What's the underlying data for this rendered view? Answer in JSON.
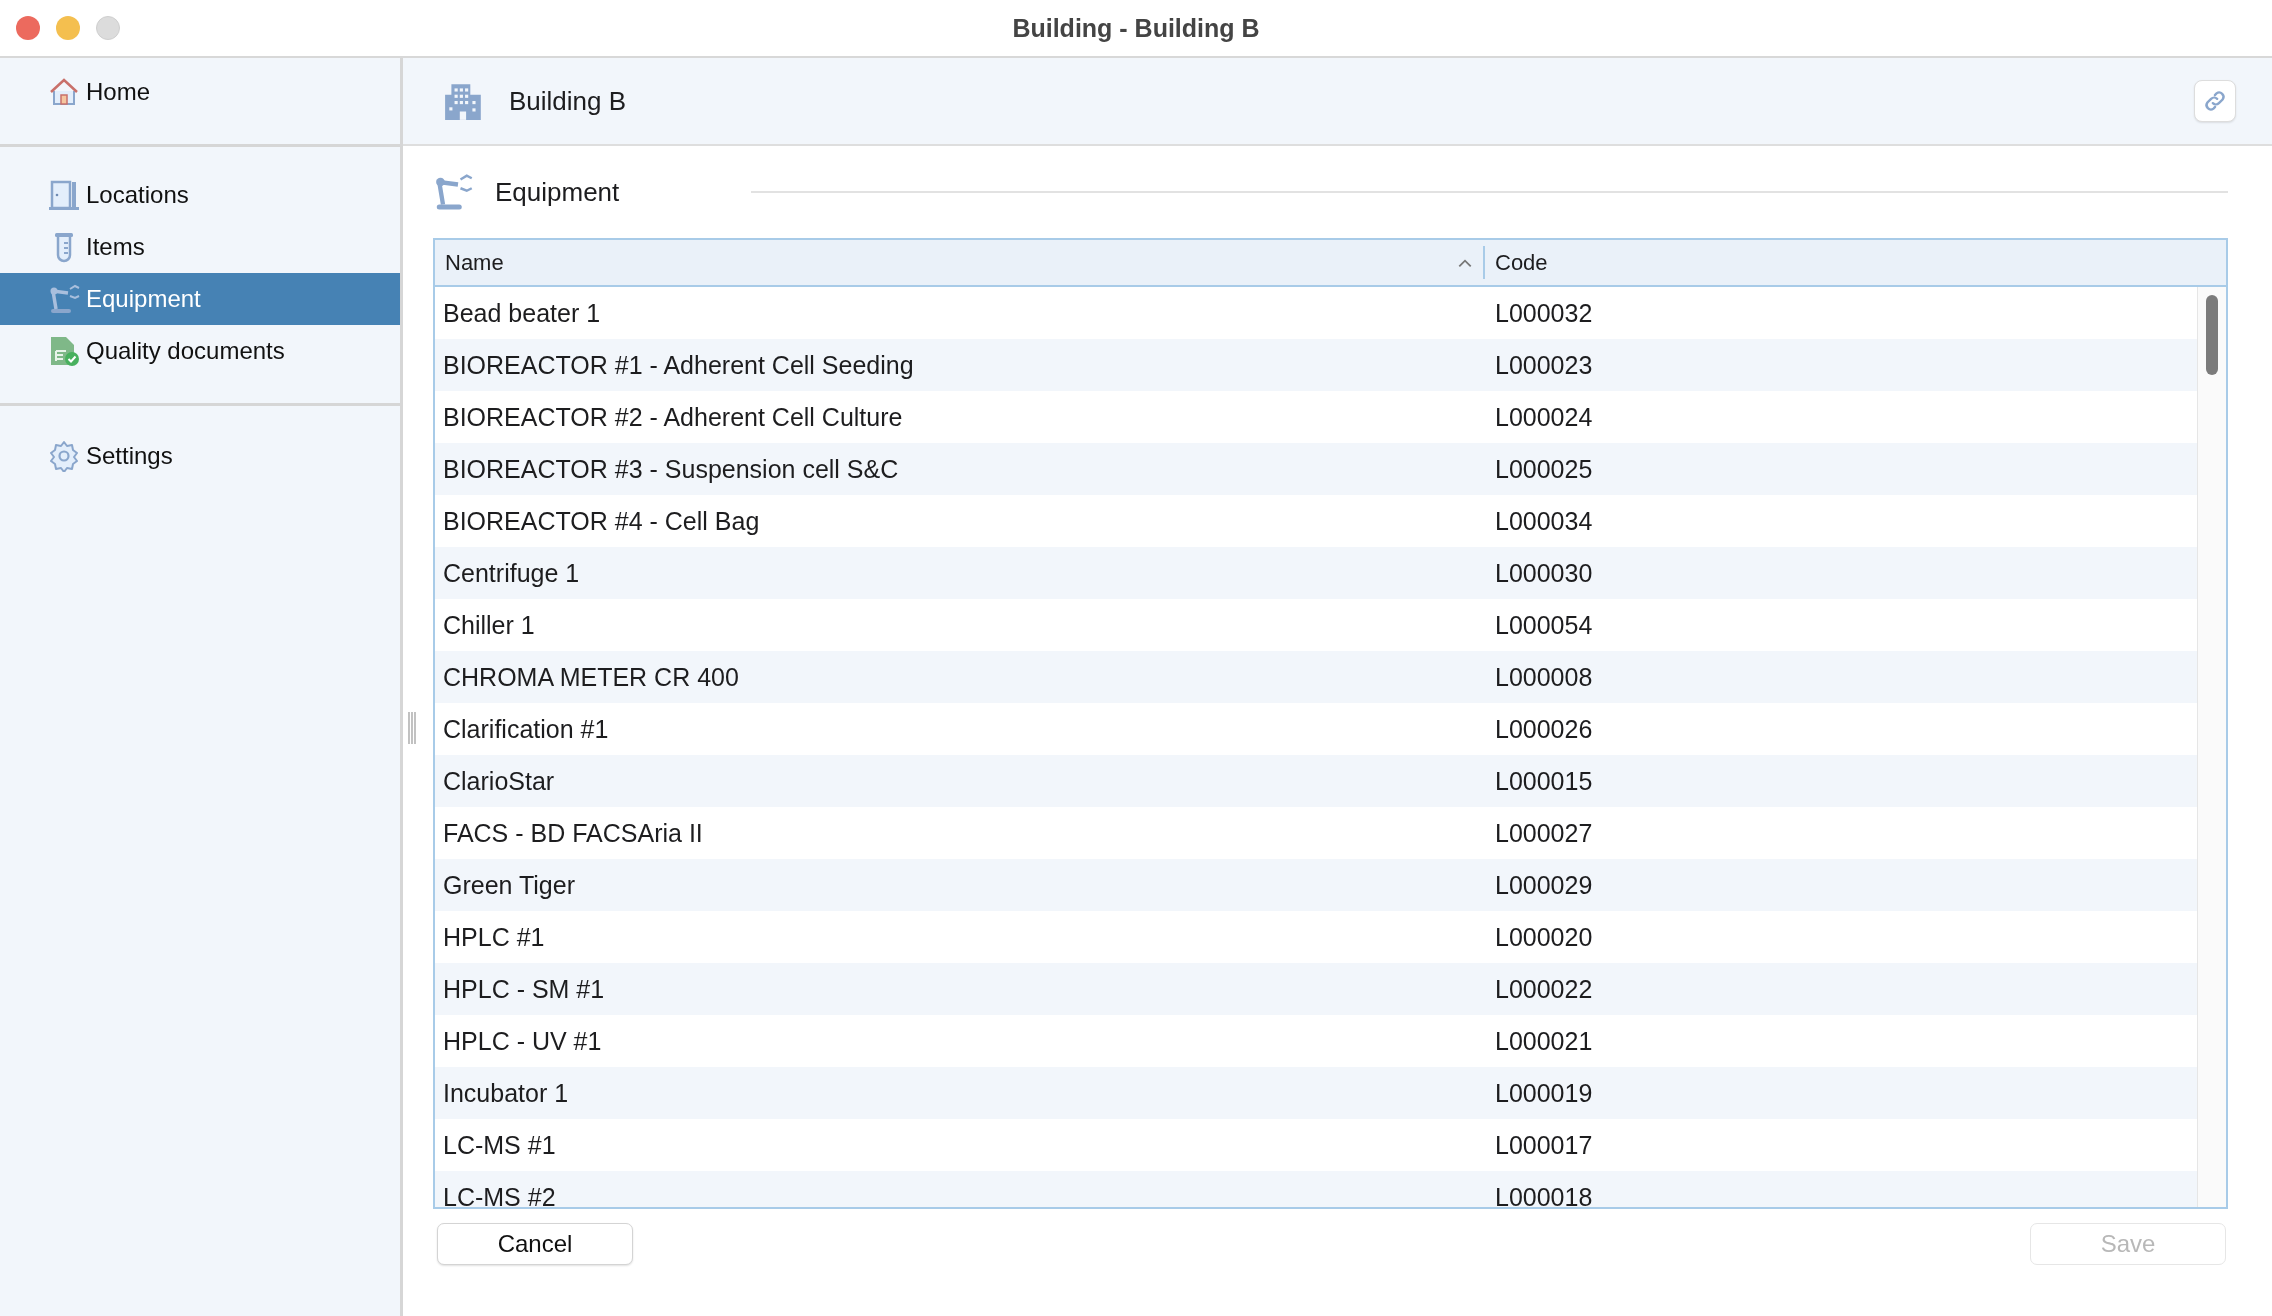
{
  "window": {
    "title": "Building - Building B"
  },
  "sidebar": {
    "groups": [
      [
        {
          "label": "Home",
          "kind": "home",
          "selected": false
        }
      ],
      [
        {
          "label": "Locations",
          "kind": "door",
          "selected": false
        },
        {
          "label": "Items",
          "kind": "tube",
          "selected": false
        },
        {
          "label": "Equipment",
          "kind": "robot",
          "selected": true
        },
        {
          "label": "Quality documents",
          "kind": "doc",
          "selected": false
        }
      ],
      [
        {
          "label": "Settings",
          "kind": "gear",
          "selected": false
        }
      ]
    ]
  },
  "header": {
    "title": "Building B"
  },
  "section": {
    "title": "Equipment"
  },
  "table": {
    "columns": [
      {
        "label": "Name",
        "sorted": true
      },
      {
        "label": "Code",
        "sorted": false
      }
    ],
    "rows": [
      [
        "Bead beater 1",
        "L000032"
      ],
      [
        "BIOREACTOR #1 - Adherent Cell Seeding",
        "L000023"
      ],
      [
        "BIOREACTOR #2 - Adherent Cell Culture",
        "L000024"
      ],
      [
        "BIOREACTOR #3 - Suspension cell S&C",
        "L000025"
      ],
      [
        "BIOREACTOR #4 - Cell Bag",
        "L000034"
      ],
      [
        "Centrifuge 1",
        "L000030"
      ],
      [
        "Chiller 1",
        "L000054"
      ],
      [
        "CHROMA METER CR 400",
        "L000008"
      ],
      [
        "Clarification #1",
        "L000026"
      ],
      [
        "ClarioStar",
        "L000015"
      ],
      [
        "FACS - BD FACSAria II",
        "L000027"
      ],
      [
        "Green Tiger",
        "L000029"
      ],
      [
        "HPLC #1",
        "L000020"
      ],
      [
        "HPLC - SM #1",
        "L000022"
      ],
      [
        "HPLC - UV #1",
        "L000021"
      ],
      [
        "Incubator 1",
        "L000019"
      ],
      [
        "LC-MS #1",
        "L000017"
      ],
      [
        "LC-MS #2",
        "L000018"
      ]
    ]
  },
  "buttons": [
    {
      "label": "Cancel",
      "disabled": false
    },
    {
      "label": "Save",
      "disabled": true
    }
  ]
}
